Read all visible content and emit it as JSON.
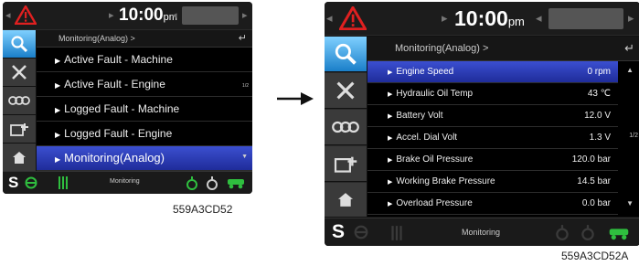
{
  "screen_a": {
    "time": "10:00",
    "ampm": "pm",
    "breadcrumb": "Monitoring(Analog) >",
    "menu": [
      {
        "label": "Active Fault - Machine"
      },
      {
        "label": "Active Fault - Engine"
      },
      {
        "label": "Logged Fault - Machine"
      },
      {
        "label": "Logged Fault - Engine"
      },
      {
        "label": "Monitoring(Analog)"
      }
    ],
    "page": "1/2",
    "bottom_label": "Monitoring",
    "s_label": "S",
    "caption": "559A3CD52"
  },
  "screen_b": {
    "time": "10:00",
    "ampm": "pm",
    "breadcrumb": "Monitoring(Analog) >",
    "rows": [
      {
        "label": "Engine Speed",
        "value": "0 rpm"
      },
      {
        "label": "Hydraulic Oil Temp",
        "value": "43 ℃"
      },
      {
        "label": "Battery Volt",
        "value": "12.0 V"
      },
      {
        "label": "Accel. Dial Volt",
        "value": "1.3 V"
      },
      {
        "label": "Brake Oil Pressure",
        "value": "120.0 bar"
      },
      {
        "label": "Working Brake Pressure",
        "value": "14.5 bar"
      },
      {
        "label": "Overload Pressure",
        "value": "0.0 bar"
      }
    ],
    "page": "1/2",
    "bottom_label": "Monitoring",
    "s_label": "S",
    "caption": "559A3CD52A"
  },
  "colors": {
    "selection": "#2a3cb8",
    "active_tab": "#3aa0e8",
    "warning": "#e02020",
    "green": "#2fbf3f"
  }
}
